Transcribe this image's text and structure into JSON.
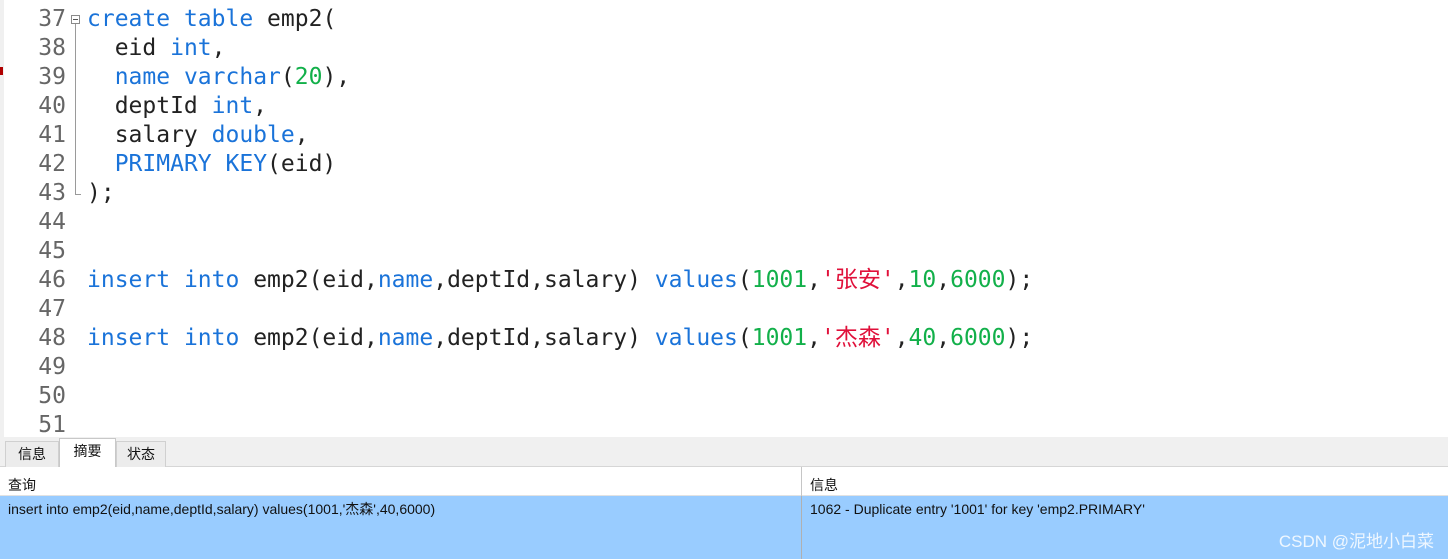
{
  "editor": {
    "lines": [
      {
        "num": "37",
        "tokens": [
          [
            "kw",
            "create"
          ],
          [
            "p",
            " "
          ],
          [
            "kw",
            "table"
          ],
          [
            "p",
            " emp2("
          ]
        ]
      },
      {
        "num": "38",
        "tokens": [
          [
            "p",
            "  eid "
          ],
          [
            "kw",
            "int"
          ],
          [
            "p",
            ","
          ]
        ]
      },
      {
        "num": "39",
        "tokens": [
          [
            "p",
            "  "
          ],
          [
            "kw",
            "name"
          ],
          [
            "p",
            " "
          ],
          [
            "kw",
            "varchar"
          ],
          [
            "p",
            "("
          ],
          [
            "num",
            "20"
          ],
          [
            "p",
            "),"
          ]
        ]
      },
      {
        "num": "40",
        "tokens": [
          [
            "p",
            "  deptId "
          ],
          [
            "kw",
            "int"
          ],
          [
            "p",
            ","
          ]
        ]
      },
      {
        "num": "41",
        "tokens": [
          [
            "p",
            "  salary "
          ],
          [
            "kw",
            "double"
          ],
          [
            "p",
            ","
          ]
        ]
      },
      {
        "num": "42",
        "tokens": [
          [
            "p",
            "  "
          ],
          [
            "kw",
            "PRIMARY"
          ],
          [
            "p",
            " "
          ],
          [
            "kw",
            "KEY"
          ],
          [
            "p",
            "(eid)"
          ]
        ]
      },
      {
        "num": "43",
        "tokens": [
          [
            "p",
            ");"
          ]
        ]
      },
      {
        "num": "44",
        "tokens": []
      },
      {
        "num": "45",
        "tokens": []
      },
      {
        "num": "46",
        "tokens": [
          [
            "kw",
            "insert"
          ],
          [
            "p",
            " "
          ],
          [
            "kw",
            "into"
          ],
          [
            "p",
            " emp2(eid,"
          ],
          [
            "kw",
            "name"
          ],
          [
            "p",
            ",deptId,salary) "
          ],
          [
            "kw",
            "values"
          ],
          [
            "p",
            "("
          ],
          [
            "num",
            "1001"
          ],
          [
            "p",
            ","
          ],
          [
            "str",
            "'张安'"
          ],
          [
            "p",
            ","
          ],
          [
            "num",
            "10"
          ],
          [
            "p",
            ","
          ],
          [
            "num",
            "6000"
          ],
          [
            "p",
            ");"
          ]
        ]
      },
      {
        "num": "47",
        "tokens": []
      },
      {
        "num": "48",
        "tokens": [
          [
            "kw",
            "insert"
          ],
          [
            "p",
            " "
          ],
          [
            "kw",
            "into"
          ],
          [
            "p",
            " emp2(eid,"
          ],
          [
            "kw",
            "name"
          ],
          [
            "p",
            ",deptId,salary) "
          ],
          [
            "kw",
            "values"
          ],
          [
            "p",
            "("
          ],
          [
            "num",
            "1001"
          ],
          [
            "p",
            ","
          ],
          [
            "str",
            "'杰森'"
          ],
          [
            "p",
            ","
          ],
          [
            "num",
            "40"
          ],
          [
            "p",
            ","
          ],
          [
            "num",
            "6000"
          ],
          [
            "p",
            ");"
          ]
        ]
      },
      {
        "num": "49",
        "tokens": []
      },
      {
        "num": "50",
        "tokens": []
      },
      {
        "num": "51",
        "tokens": []
      }
    ]
  },
  "colors": {
    "keyword": "#1a73d9",
    "number": "#12b04a",
    "string": "#e0103a",
    "selected_row": "#99ccff"
  },
  "tabs": [
    {
      "label": "信息",
      "active": false
    },
    {
      "label": "摘要",
      "active": true
    },
    {
      "label": "状态",
      "active": false
    }
  ],
  "result": {
    "headers": {
      "query": "查询",
      "message": "信息"
    },
    "row": {
      "query": "insert into emp2(eid,name,deptId,salary) values(1001,'杰森',40,6000)",
      "message": "1062 - Duplicate entry '1001' for key 'emp2.PRIMARY'"
    }
  },
  "watermark": "CSDN @泥地小白菜"
}
